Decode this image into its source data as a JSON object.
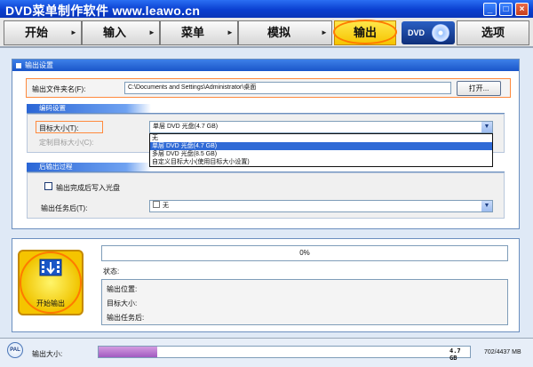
{
  "window": {
    "title": "DVD菜单制作软件 www.leawo.cn",
    "minimize": "_",
    "maximize": "□",
    "close": "×"
  },
  "nav": {
    "tabs": [
      {
        "label": "开始"
      },
      {
        "label": "输入"
      },
      {
        "label": "菜单"
      },
      {
        "label": "模拟"
      },
      {
        "label": "输出"
      },
      {
        "label": "选项"
      }
    ],
    "arrow": "►",
    "active_tab": "输出",
    "logo_text": "DVD"
  },
  "output_settings": {
    "header": "输出设置",
    "folder_label": "输出文件夹名(F):",
    "folder_value": "C:\\Documents and Settings\\Administrator\\桌面",
    "open_button": "打开..."
  },
  "encoding": {
    "header": "编码设置",
    "target_size_label": "目标大小(T):",
    "target_size_value": "单层 DVD 光盘(4.7 GB)",
    "custom_size_label": "定制目标大小(C):",
    "options": [
      {
        "label": "无",
        "selected": false
      },
      {
        "label": "单层 DVD 光盘(4.7 GB)",
        "selected": true
      },
      {
        "label": "多层 DVD 光盘(8.5 GB)",
        "selected": false
      },
      {
        "label": "自定义目标大小(使用目标大小设置)",
        "selected": false
      }
    ]
  },
  "post_output": {
    "header": "后输出过程",
    "burn_checkbox_label": "输出完成后写入光盘",
    "burn_checked": false,
    "task_after_label": "输出任务后(T):",
    "task_after_value": "无"
  },
  "progress": {
    "percent_text": "0%",
    "percent": 0,
    "status_label": "状态:",
    "output_location_label": "输出位置:",
    "target_size_label": "目标大小:",
    "task_after_label": "输出任务后:",
    "start_button": "开始输出"
  },
  "bottom": {
    "pal_badge": "PAL",
    "output_size_label": "输出大小:",
    "size_marker": "4.7 GB",
    "size_readout": "702/4437 MB",
    "used_mb": 702,
    "capacity_mb": 4437
  },
  "colors": {
    "titlebar": "#0a3fd0",
    "accent": "#2f6ad6",
    "active_tab": "#f5c400",
    "highlight": "#ff8a3d",
    "size_fill": "#a15ac0"
  }
}
